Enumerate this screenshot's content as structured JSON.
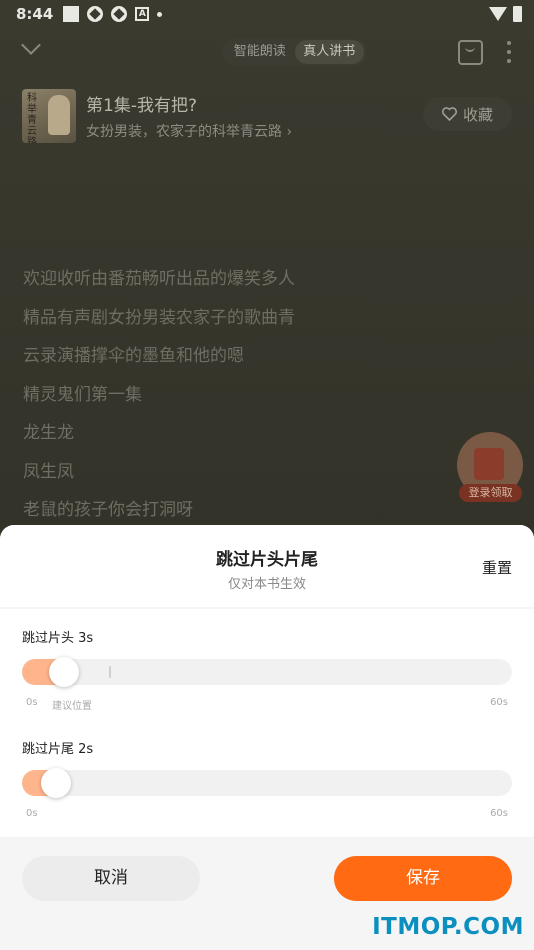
{
  "status_bar": {
    "time": "8:44",
    "icons": [
      "square-icon",
      "app-icon",
      "app-icon",
      "a-icon",
      "dot-icon",
      "wifi-icon",
      "battery-icon"
    ]
  },
  "player": {
    "mode_tabs": [
      {
        "label": "智能朗读",
        "active": false
      },
      {
        "label": "真人讲书",
        "active": true
      }
    ],
    "episode_title": "第1集-我有把?",
    "book_name": "女扮男装，农家子的科举青云路 ›",
    "favorite_label": "收藏",
    "lyrics": [
      "欢迎收听由番茄畅听出品的爆笑多人",
      "精品有声剧女扮男装农家子的歌曲青",
      "云录演播撑伞的墨鱼和他的嗯",
      "精灵鬼们第一集",
      "龙生龙",
      "凤生凤",
      "老鼠的孩子你会打洞呀"
    ],
    "gift_label": "登录领取"
  },
  "sheet": {
    "title": "跳过片头片尾",
    "subtitle": "仅对本书生效",
    "reset_label": "重置",
    "intro": {
      "label": "跳过片头 3s",
      "value": 3,
      "min_label": "0s",
      "max_label": "60s",
      "hint": "建议位置",
      "suggest_value": 9
    },
    "outro": {
      "label": "跳过片尾 2s",
      "value": 2,
      "min_label": "0s",
      "max_label": "60s"
    },
    "cancel_label": "取消",
    "save_label": "保存"
  },
  "watermark": "ITMOP.COM",
  "colors": {
    "accent": "#ff6a13",
    "slider_fill": "#ffb58c",
    "watermark": "#0a8fbf"
  }
}
